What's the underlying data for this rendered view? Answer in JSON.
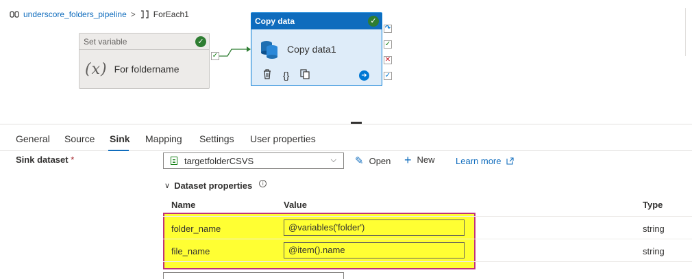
{
  "breadcrumb": {
    "pipeline": "underscore_folders_pipeline",
    "separator": ">",
    "activity": "ForEach1"
  },
  "activities": {
    "set_variable": {
      "type_label": "Set variable",
      "icon_text": "(x)",
      "name": "For foldername"
    },
    "copy_data": {
      "type_label": "Copy data",
      "name": "Copy data1",
      "code_icon": "{}"
    }
  },
  "tabs": [
    {
      "label": "General"
    },
    {
      "label": "Source"
    },
    {
      "label": "Sink"
    },
    {
      "label": "Mapping"
    },
    {
      "label": "Settings"
    },
    {
      "label": "User properties"
    }
  ],
  "active_tab": "Sink",
  "sink": {
    "label": "Sink dataset",
    "required_mark": "*",
    "dataset_value": "targetfolderCSVS",
    "open_label": "Open",
    "new_label": "New",
    "learn_more": "Learn more",
    "dataset_properties_label": "Dataset properties"
  },
  "table": {
    "headers": {
      "name": "Name",
      "value": "Value",
      "type": "Type"
    },
    "rows": [
      {
        "name": "folder_name",
        "value": "@variables('folder')",
        "type": "string"
      },
      {
        "name": "file_name",
        "value": "@item().name",
        "type": "string"
      }
    ]
  },
  "colors": {
    "accent": "#0f6cbd",
    "highlight": "#ffff33",
    "highlight_border": "#c0317a",
    "success": "#2e7d32"
  },
  "icons": [
    "pipeline-icon",
    "foreach-icon",
    "check-circle-icon",
    "copy-data-icon",
    "delete-icon",
    "code-icon",
    "clone-icon",
    "arrow-circle-icon",
    "dataset-icon",
    "chevron-down-icon",
    "pencil-icon",
    "plus-icon",
    "external-link-icon",
    "info-icon"
  ]
}
